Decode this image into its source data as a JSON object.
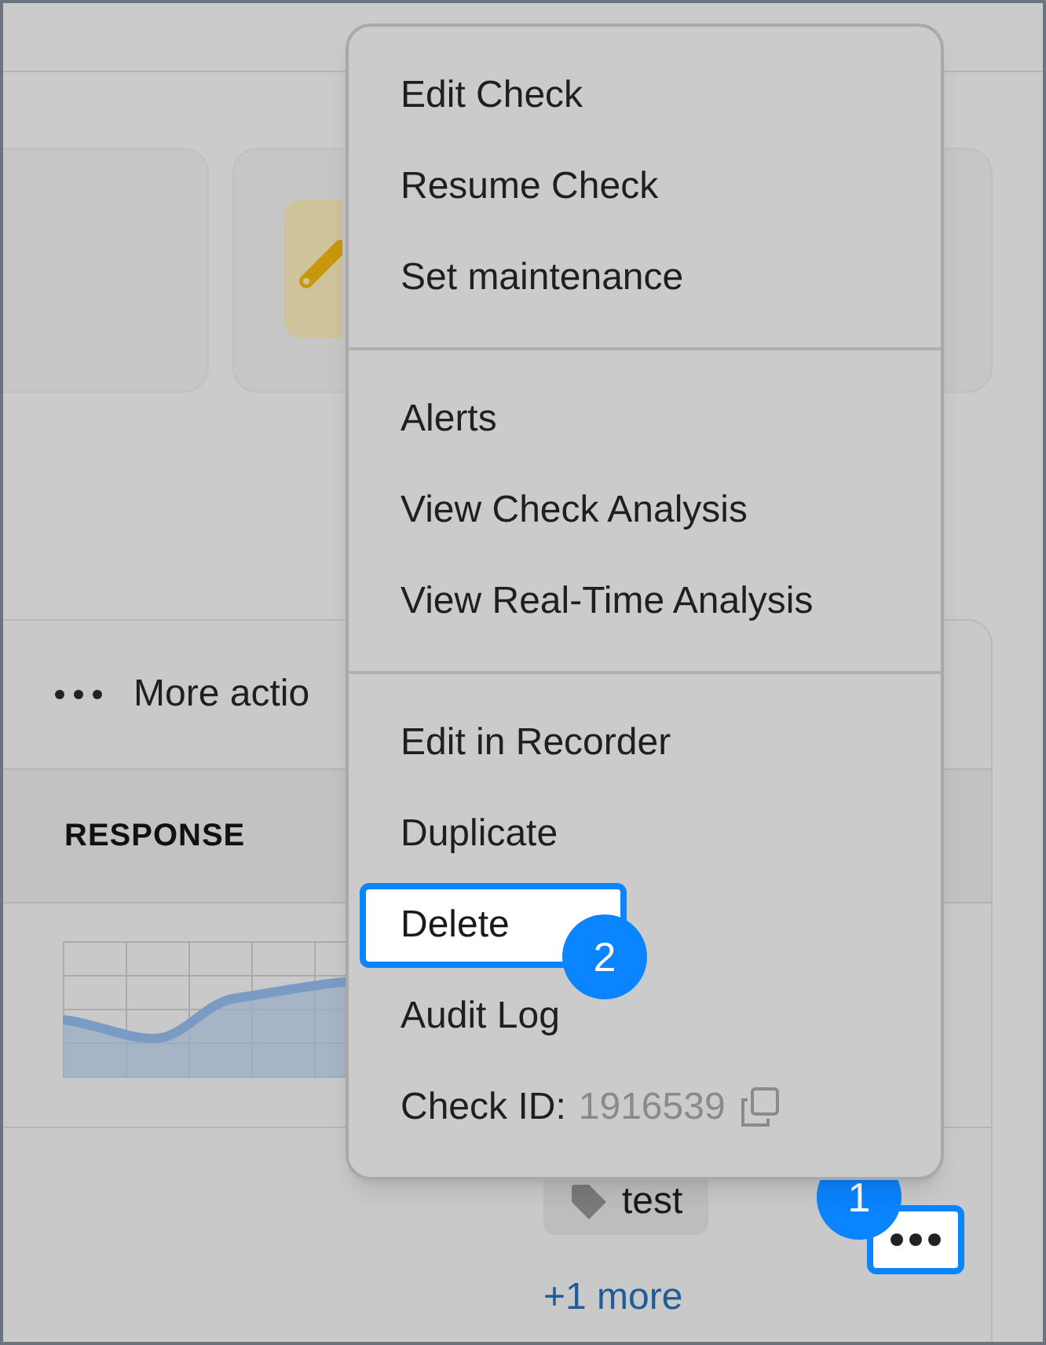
{
  "panel": {
    "more_actions_label": "More actio",
    "column_header": "RESPONSE",
    "tag": "test",
    "more_link": "+1 more",
    "more_button": {
      "step_badge": "1",
      "highlighted": true
    }
  },
  "menu": {
    "sections": [
      [
        {
          "kind": "item",
          "label": "Edit Check",
          "highlighted": false
        },
        {
          "kind": "item",
          "label": "Resume Check",
          "highlighted": false
        },
        {
          "kind": "item",
          "label": "Set maintenance",
          "highlighted": false
        }
      ],
      [
        {
          "kind": "item",
          "label": "Alerts",
          "highlighted": false
        },
        {
          "kind": "item",
          "label": "View Check Analysis",
          "highlighted": false
        },
        {
          "kind": "item",
          "label": "View Real-Time Analysis",
          "highlighted": false
        }
      ],
      [
        {
          "kind": "item",
          "label": "Edit in Recorder",
          "highlighted": false
        },
        {
          "kind": "item",
          "label": "Duplicate",
          "highlighted": false
        },
        {
          "kind": "item",
          "label": "Delete",
          "highlighted": true,
          "step_badge": "2"
        },
        {
          "kind": "item",
          "label": "Audit Log",
          "highlighted": false
        },
        {
          "kind": "id",
          "label": "Check ID:",
          "value": "1916539"
        }
      ]
    ]
  }
}
